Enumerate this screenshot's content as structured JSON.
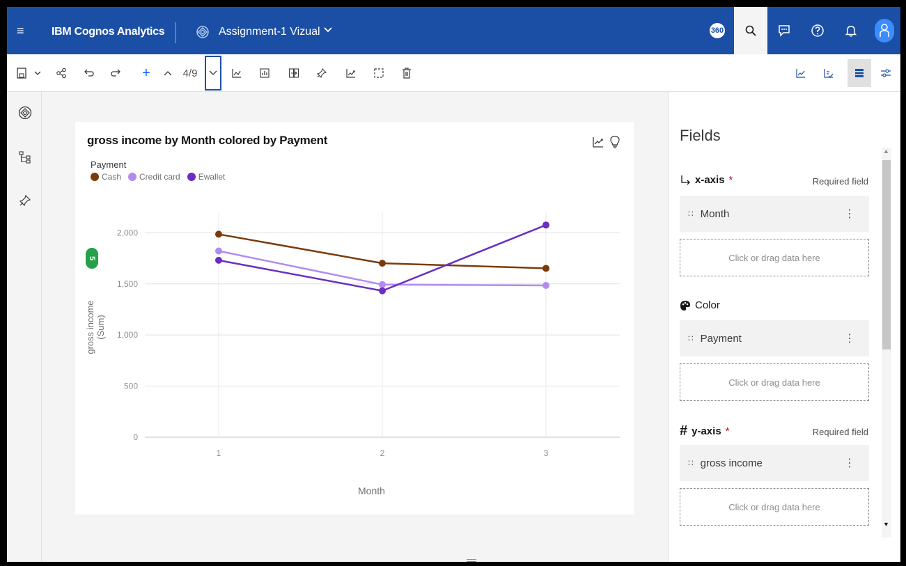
{
  "header": {
    "app_title": "IBM Cognos Analytics",
    "report_name": "Assignment-1 Vizual",
    "badge_360": "360"
  },
  "toolbar": {
    "page_counter": "4/9"
  },
  "chart_card": {
    "title": "gross income by Month colored by Payment",
    "legend_title": "Payment",
    "badge_count": "5"
  },
  "chart_data": {
    "type": "line",
    "title": "gross income by Month colored by Payment",
    "xlabel": "Month",
    "ylabel": "gross income (Sum)",
    "x": [
      1,
      2,
      3
    ],
    "x_tick_labels": [
      "1",
      "2",
      "3"
    ],
    "y_tick_labels": [
      "0",
      "500",
      "1,000",
      "1,500",
      "2,000"
    ],
    "ylim": [
      0,
      2200
    ],
    "grid": true,
    "legend_position": "top-left",
    "series": [
      {
        "name": "Cash",
        "color": "#7a3b0b",
        "values": [
          1986,
          1702,
          1652
        ]
      },
      {
        "name": "Credit card",
        "color": "#b38bf0",
        "values": [
          1822,
          1493,
          1485
        ]
      },
      {
        "name": "Ewallet",
        "color": "#6a2ec0",
        "values": [
          1731,
          1432,
          2076
        ]
      }
    ]
  },
  "fields_panel": {
    "title": "Fields",
    "x_axis": {
      "label": "x-axis",
      "required_star": "*",
      "required_text": "Required field",
      "field": "Month",
      "drop_hint": "Click or drag data here"
    },
    "color": {
      "label": "Color",
      "field": "Payment",
      "drop_hint": "Click or drag data here"
    },
    "y_axis": {
      "label": "y-axis",
      "required_star": "*",
      "required_text": "Required field",
      "field": "gross income",
      "drop_hint": "Click or drag data here"
    }
  }
}
